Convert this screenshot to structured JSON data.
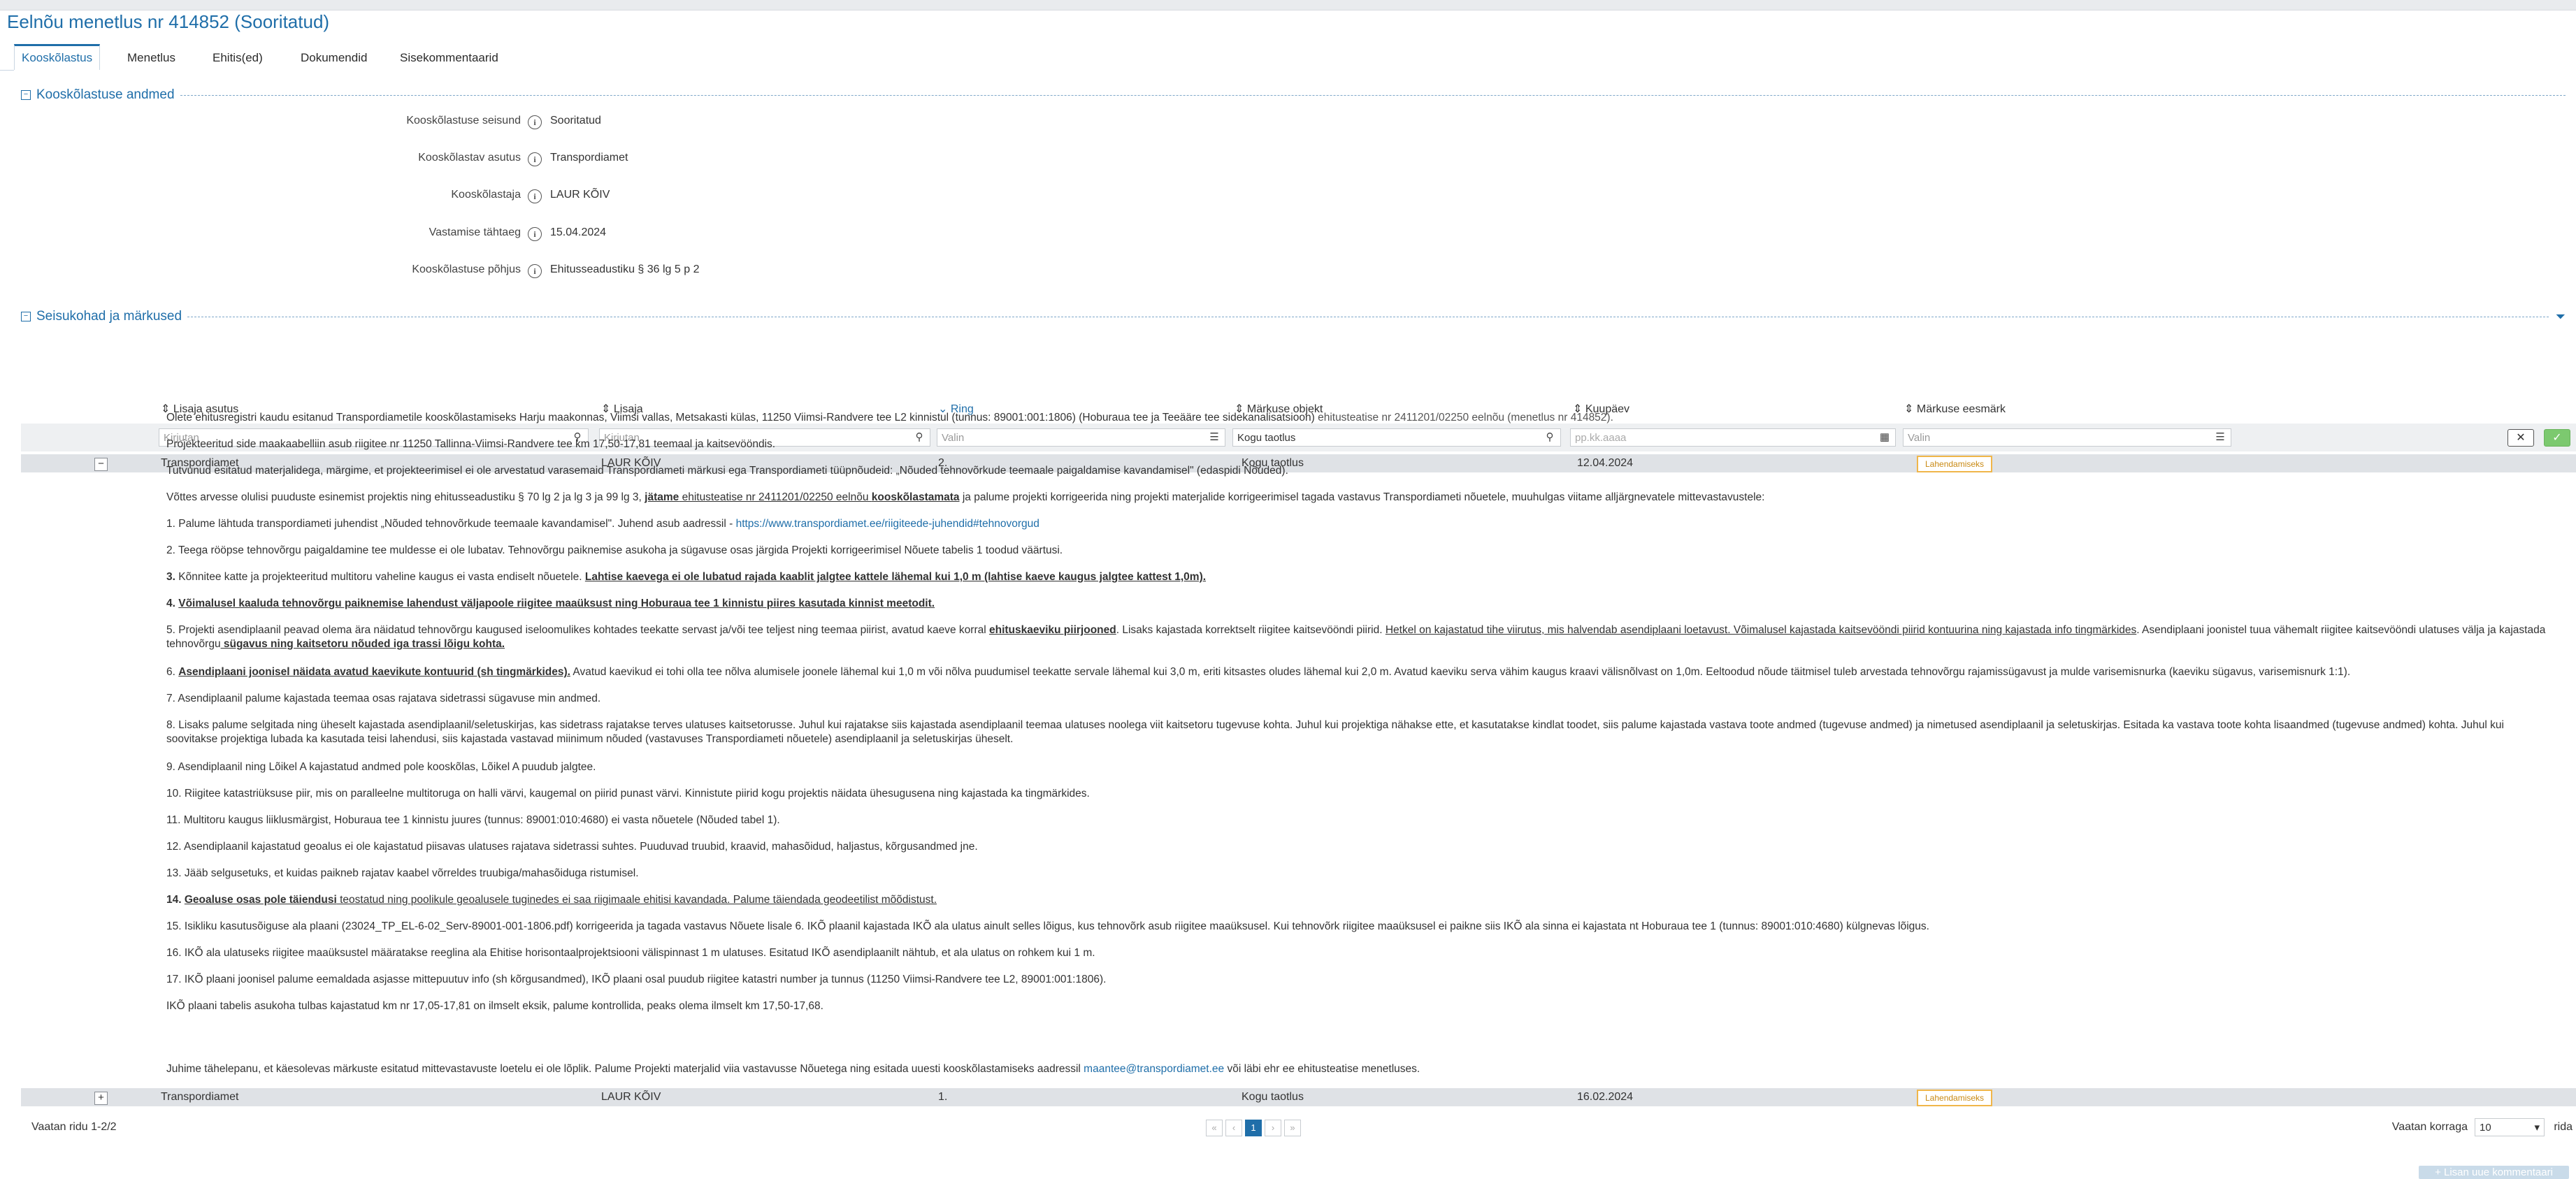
{
  "page_title": "Eelnõu menetlus nr 414852 (Sooritatud)",
  "tabs": [
    {
      "label": "Kooskõlastus"
    },
    {
      "label": "Menetlus"
    },
    {
      "label": "Ehitis(ed)"
    },
    {
      "label": "Dokumendid"
    },
    {
      "label": "Sisekommentaarid"
    }
  ],
  "section1": {
    "title": "Kooskõlastuse andmed",
    "fields": [
      {
        "label": "Kooskõlastuse seisund",
        "value": "Sooritatud"
      },
      {
        "label": "Kooskõlastav asutus",
        "value": "Transpordiamet"
      },
      {
        "label": "Kooskõlastaja",
        "value": "LAUR KÕIV"
      },
      {
        "label": "Vastamise tähtaeg",
        "value": "15.04.2024"
      },
      {
        "label": "Kooskõlastuse põhjus",
        "value": "Ehitusseadustiku § 36 lg 5 p 2"
      }
    ]
  },
  "section2": {
    "title": "Seisukohad ja märkused",
    "columns": [
      "Lisaja asutus",
      "Lisaja",
      "Ring",
      "Märkuse objekt",
      "Kuupäev",
      "Märkuse eesmärk"
    ],
    "filters": {
      "col1": "Kirjutan",
      "col2": "Kirjutan",
      "col3": "Valin",
      "col4": "Kogu taotlus",
      "col5": "pp.kk.aaaa",
      "col6": "Valin"
    },
    "rows": [
      {
        "toggle": "−",
        "org": "Transpordiamet",
        "user": "LAUR KÕIV",
        "ring": "2.",
        "object": "Kogu taotlus",
        "date": "12.04.2024",
        "purpose": "Lahendamiseks"
      },
      {
        "toggle": "+",
        "org": "Transpordiamet",
        "user": "LAUR KÕIV",
        "ring": "1.",
        "object": "Kogu taotlus",
        "date": "16.02.2024",
        "purpose": "Lahendamiseks"
      }
    ]
  },
  "detail": {
    "p1": "Olete ehitusregistri kaudu esitanud Transpordiametile kooskõlastamiseks Harju maakonnas, Viimsi vallas, Metsakasti külas, 11250 Viimsi-Randvere tee L2 kinnistul (tunnus: 89001:001:1806) (Hoburaua tee ja Teeääre tee sidekanalisatsioon)",
    "p1b": " ehitusteatise nr 2411201/02250 eelnõu (menetlus nr 414852).",
    "p2": "Projekteeritud side maakaabelliin asub riigitee nr 11250 Tallinna-Viimsi-Randvere tee km 17,50-17,81 teemaal ja kaitsevööndis.",
    "p3": "Tutvunud esitatud materjalidega, märgime, et projekteerimisel ei ole arvestatud varasemaid Transpordiameti märkusi ega Transpordiameti tüüpnõudeid: „Nõuded tehnovõrkude teemaale paigaldamise kavandamisel\" (edaspidi Nõuded).",
    "p4a": "Võttes arvesse olulisi puuduste esinemist projektis ning ehitusseadustiku § 70 lg 2 ja lg 3 ja 99 lg 3,",
    "p4b": "jätame",
    "p4c": " ehitusteatise nr 2411201/02250 eelnõu ",
    "p4d": "kooskõlastamata",
    "p4e": " ja palume projekti korrigeerida ning projekti materjalide korrigeerimisel tagada vastavus Transpordiameti nõuetele, muuhulgas viitame alljärgnevatele mittevastavustele:",
    "i1a": "1. Palume lähtuda transpordiameti juhendist „Nõuded tehnovõrkude teemaale kavandamisel\". Juhend asub aadressil - ",
    "i1link": "https://www.transpordiamet.ee/riigiteede-juhendid#tehnovorgud",
    "i2": "2. Teega rööpse tehnovõrgu paigaldamine tee muldesse ei ole lubatav. Tehnovõrgu paiknemise asukoha ja sügavuse osas järgida Projekti korrigeerimisel Nõuete tabelis 1 toodud väärtusi.",
    "i3a": "3.",
    "i3b": " Kõnnitee katte ja projekteeritud multitoru vaheline kaugus ei vasta endiselt nõuetele. ",
    "i3c": "Lahtise kaevega ei ole lubatud rajada kaablit jalgtee kattele lähemal kui 1,0 m (lahtise kaeve kaugus jalgtee kattest 1,0m).",
    "i4a": "4. ",
    "i4b": "Võimalusel kaaluda tehnovõrgu paiknemise lahendust väljapoole riigitee maaüksust ning Hoburaua tee 1 kinnistu piires kasutada kinnist meetodit.",
    "i5a": "5. Projekti asendiplaanil peavad olema ära näidatud tehnovõrgu kaugused iseloomulikes kohtades teekatte servast ja/või tee teljest ning teemaa piirist, avatud kaeve korral ",
    "i5b": "ehituskaeviku piirjooned",
    "i5c": ". Lisaks kajastada korrektselt riigitee kaitsevööndi piirid. ",
    "i5d": "Hetkel on kajastatud tihe viirutus, mis halvendab asendiplaani loetavust. Võimalusel kajastada kaitsevööndi piirid kontuurina ning kajastada info tingmärkides",
    "i5e": ". Asendiplaani joonistel tuua vähemalt riigitee kaitsevööndi ulatuses välja ja kajastada tehnovõrgu",
    "i5f": " sügavus ning kaitsetoru nõuded iga trassi lõigu kohta.",
    "i6a": "6. ",
    "i6b": "Asendiplaani joonisel näidata avatud kaevikute kontuurid (sh tingmärkides).",
    "i6c": " Avatud kaevikud ei tohi olla tee nõlva alumisele joonele lähemal kui 1,0 m või nõlva puudumisel teekatte servale lähemal kui 3,0 m, eriti kitsastes oludes lähemal kui 2,0 m. Avatud kaeviku serva vähim kaugus kraavi välisnõlvast on 1,0m. Eeltoodud nõude täitmisel tuleb arvestada tehnovõrgu rajamissügavust ja mulde varisemisnurka (kaeviku sügavus, varisemisnurk 1:1).",
    "i7": "7. Asendiplaanil palume kajastada teemaa osas rajatava sidetrassi sügavuse min andmed.",
    "i8": "8. Lisaks palume selgitada ning üheselt kajastada asendiplaanil/seletuskirjas, kas sidetrass rajatakse terves ulatuses kaitsetorusse. Juhul kui rajatakse siis kajastada asendiplaanil teemaa ulatuses noolega viit kaitsetoru tugevuse kohta. Juhul kui projektiga nähakse ette, et kasutatakse kindlat toodet, siis palume kajastada vastava toote andmed (tugevuse andmed) ja nimetused asendiplaanil ja seletuskirjas. Esitada ka vastava toote kohta lisaandmed (tugevuse andmed) kohta. Juhul kui soovitakse projektiga lubada ka kasutada teisi lahendusi, siis kajastada vastavad miinimum nõuded (vastavuses Transpordiameti nõuetele) asendiplaanil ja seletuskirjas üheselt.",
    "i9": "9. Asendiplaanil ning Lõikel A kajastatud andmed pole kooskõlas, Lõikel A puudub jalgtee.",
    "i10": "10. Riigitee katastriüksuse piir, mis on paralleelne multitoruga on halli värvi, kaugemal on piirid punast värvi. Kinnistute piirid kogu projektis näidata ühesugusena ning kajastada ka tingmärkides.",
    "i11": "11.  Multitoru kaugus liiklusmärgist, Hoburaua tee 1 kinnistu juures (tunnus: 89001:010:4680) ei vasta nõuetele (Nõuded tabel 1).",
    "i12": "12.  Asendiplaanil kajastatud geoalus ei ole kajastatud piisavas ulatuses rajatava sidetrassi suhtes. Puuduvad truubid, kraavid, mahasõidud, haljastus, kõrgusandmed jne.",
    "i13": "13.  Jääb selgusetuks, et kuidas paikneb rajatav kaabel võrreldes truubiga/mahasõiduga ristumisel.",
    "i14a": "14.  ",
    "i14b": "Geoaluse osas pole täiendusi",
    "i14c": " teostatud ning poolikule geoalusele tuginedes ei saa riigimaale ehitisi kavandada. Palume täiendada geodeetilist mõõdistust.",
    "i15": "15.  Isikliku kasutusõiguse ala plaani (23024_TP_EL-6-02_Serv-89001-001-1806.pdf) korrigeerida ja tagada vastavus Nõuete lisale 6. IKÕ plaanil kajastada IKÕ ala ulatus ainult selles lõigus, kus tehnovõrk asub riigitee maaüksusel. Kui tehnovõrk riigitee maaüksusel ei paikne siis IKÕ ala sinna ei kajastata nt Hoburaua tee 1 (tunnus: 89001:010:4680) külgnevas lõigus.",
    "i16": "16.  IKÕ ala ulatuseks riigitee maaüksustel määratakse reeglina ala Ehitise horisontaalprojektsiooni välispinnast 1 m ulatuses. Esitatud IKÕ asendiplaanilt nähtub, et ala ulatus on rohkem kui 1 m.",
    "i17": "17.  IKÕ plaani joonisel palume eemaldada asjasse mittepuutuv info (sh kõrgusandmed), IKÕ plaani osal puudub riigitee katastri number ja tunnus (11250 Viimsi-Randvere tee L2, 89001:001:1806).",
    "i18": "IKÕ plaani tabelis asukoha tulbas kajastatud km nr 17,05-17,81 on ilmselt eksik, palume kontrollida, peaks olema ilmselt km 17,50-17,68.",
    "closing_a": "Juhime tähelepanu, et käesolevas märkuste esitatud mittevastavuste loetelu ei ole lõplik. Palume Projekti materjalid viia vastavusse Nõuetega ning esitada uuesti kooskõlastamiseks aadressil ",
    "closing_link": "maantee@transpordiamet.ee",
    "closing_b": " või läbi ehr ee ehitusteatise menetluses."
  },
  "footer": {
    "rows_info": "Vaatan ridu 1-2/2",
    "pages": [
      "«",
      "‹",
      "1",
      "›",
      "»"
    ],
    "page_size_label": "Vaatan korraga",
    "page_size": "10",
    "page_size_suffix": "rida"
  },
  "bottom_button": "+ Lisan uue kommentaari"
}
